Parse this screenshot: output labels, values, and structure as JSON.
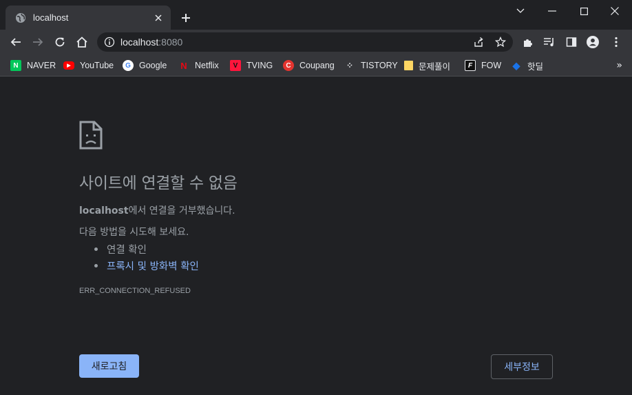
{
  "tab": {
    "title": "localhost"
  },
  "omnibox": {
    "host": "localhost",
    "port": ":8080"
  },
  "bookmarks": [
    {
      "label": "NAVER",
      "icon": "naver-icon",
      "color": "#03c75a",
      "glyph": "N"
    },
    {
      "label": "YouTube",
      "icon": "youtube-icon",
      "color": "#ff0000",
      "glyph": "▶"
    },
    {
      "label": "Google",
      "icon": "google-icon",
      "color": "#ffffff",
      "glyph": "G"
    },
    {
      "label": "Netflix",
      "icon": "netflix-icon",
      "color": "#e50914",
      "glyph": "N"
    },
    {
      "label": "TVING",
      "icon": "tving-icon",
      "color": "#ff153c",
      "glyph": "V"
    },
    {
      "label": "Coupang",
      "icon": "coupang-icon",
      "color": "#e3342f",
      "glyph": "C"
    },
    {
      "label": "TISTORY",
      "icon": "tistory-icon",
      "color": "#202124",
      "glyph": "⁘"
    },
    {
      "label": "문제풀이",
      "icon": "folder-icon",
      "color": "#fdd663",
      "glyph": ""
    },
    {
      "label": "FOW",
      "icon": "fow-icon",
      "color": "#202124",
      "glyph": "F"
    },
    {
      "label": "핫딜",
      "icon": "hotdeal-icon",
      "color": "#1a73e8",
      "glyph": "◆"
    }
  ],
  "bookmarks_more": "»",
  "error": {
    "title": "사이트에 연결할 수 없음",
    "host_bold": "localhost",
    "host_suffix": "에서 연결을 거부했습니다.",
    "try_label": "다음 방법을 시도해 보세요.",
    "suggestions": [
      {
        "text": "연결 확인",
        "link": false
      },
      {
        "text": "프록시 및 방화벽 확인",
        "link": true
      }
    ],
    "code": "ERR_CONNECTION_REFUSED",
    "reload_label": "새로고침",
    "details_label": "세부정보"
  },
  "colors": {
    "accent": "#8ab4f8",
    "background": "#202124",
    "toolbar": "#35363a"
  }
}
